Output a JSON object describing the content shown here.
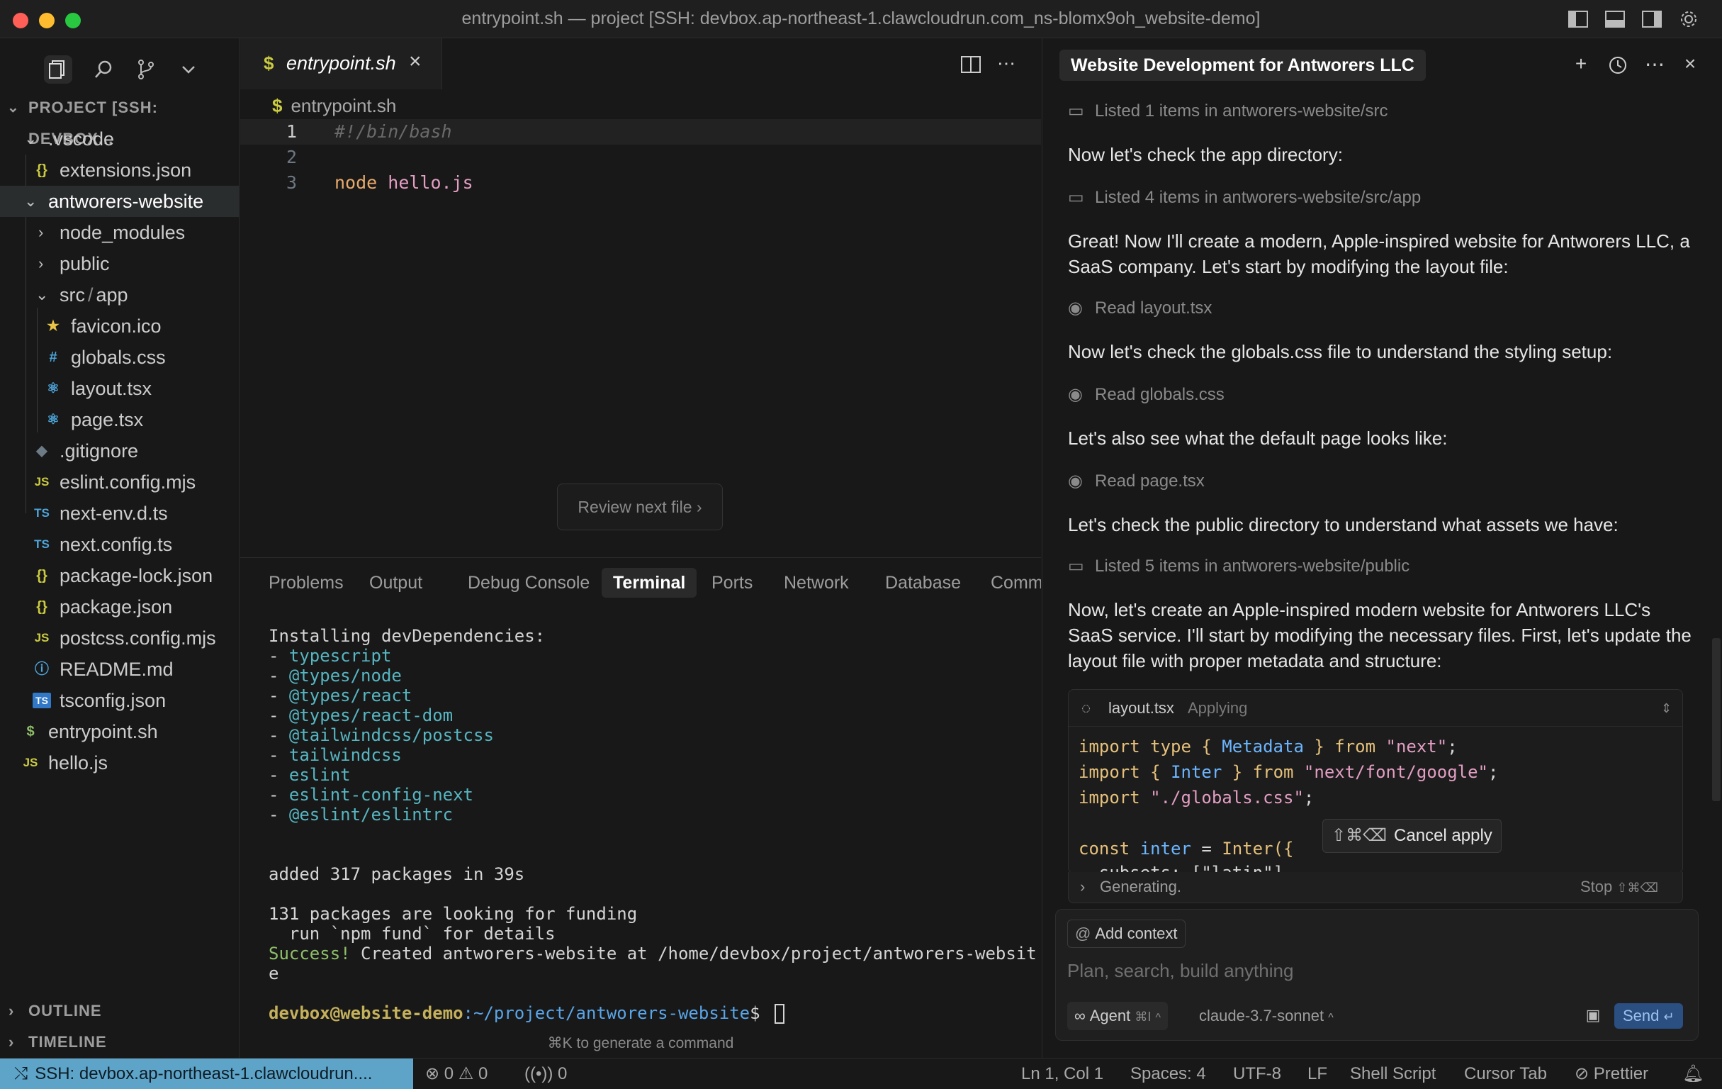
{
  "window": {
    "title": "entrypoint.sh — project [SSH: devbox.ap-northeast-1.clawcloudrun.com_ns-blomx9oh_website-demo]"
  },
  "sidebar": {
    "project_header": "PROJECT [SSH: DEVBOX...",
    "items": [
      {
        "label": ".vscode",
        "icon": "chevron-down"
      },
      {
        "label": "extensions.json",
        "icon": "{}"
      },
      {
        "label": "antworers-website",
        "icon": "chevron-down"
      },
      {
        "label": "node_modules",
        "icon": "chevron-right"
      },
      {
        "label": "public",
        "icon": "chevron-right"
      },
      {
        "label": "src",
        "icon": "chevron-down"
      },
      {
        "label": "app",
        "icon": ""
      },
      {
        "label": "favicon.ico",
        "icon": "star"
      },
      {
        "label": "globals.css",
        "icon": "#"
      },
      {
        "label": "layout.tsx",
        "icon": "react"
      },
      {
        "label": "page.tsx",
        "icon": "react"
      },
      {
        "label": ".gitignore",
        "icon": "diamond"
      },
      {
        "label": "eslint.config.mjs",
        "icon": "JS"
      },
      {
        "label": "next-env.d.ts",
        "icon": "TS"
      },
      {
        "label": "next.config.ts",
        "icon": "TS"
      },
      {
        "label": "package-lock.json",
        "icon": "{}"
      },
      {
        "label": "package.json",
        "icon": "{}"
      },
      {
        "label": "postcss.config.mjs",
        "icon": "JS"
      },
      {
        "label": "README.md",
        "icon": "info"
      },
      {
        "label": "tsconfig.json",
        "icon": "TS"
      },
      {
        "label": "entrypoint.sh",
        "icon": "$"
      },
      {
        "label": "hello.js",
        "icon": "JS"
      }
    ],
    "icon_texts": {
      "braces": "{}",
      "hash": "#",
      "js": "JS",
      "ts": "TS",
      "dollar": "$"
    },
    "outline": "OUTLINE",
    "timeline": "TIMELINE"
  },
  "editor": {
    "tab_label": "entrypoint.sh",
    "tab_icon": "$",
    "breadcrumb": "entrypoint.sh",
    "lines": [
      {
        "n": "1",
        "text": "#!/bin/bash"
      },
      {
        "n": "2",
        "text": ""
      },
      {
        "n": "3",
        "kw": "node",
        "arg": "hello.js"
      }
    ],
    "review_button": "Review next file"
  },
  "panel": {
    "tabs": [
      "Problems",
      "Output",
      "Debug Console",
      "Terminal",
      "Ports",
      "Network",
      "Database",
      "Comm"
    ],
    "active_tab": "Terminal",
    "terminal": {
      "header": "Installing devDependencies:",
      "packages": [
        "typescript",
        "@types/node",
        "@types/react",
        "@types/react-dom",
        "@tailwindcss/postcss",
        "tailwindcss",
        "eslint",
        "eslint-config-next",
        "@eslint/eslintrc"
      ],
      "dash": "- ",
      "added": "added 317 packages in 39s",
      "funding1": "131 packages are looking for funding",
      "funding2": "  run `npm fund` for details",
      "success_word": "Success!",
      "success_rest": " Created antworers-website at /home/devbox/project/antworers-websit",
      "success_wrap": "e",
      "prompt_user": "devbox@website-demo",
      "prompt_path": ":~/project/antworers-website",
      "prompt_end": "$ ",
      "hint": "⌘K to generate a command"
    }
  },
  "chat": {
    "title": "Website Development for Antworers LLC",
    "entries": {
      "tool1": "Listed 1 items in antworers-website/src",
      "msg1": "Now let's check the app directory:",
      "tool2": "Listed 4 items in antworers-website/src/app",
      "msg2": "Great! Now I'll create a modern, Apple-inspired website for Antworers LLC, a SaaS company. Let's start by modifying the layout file:",
      "tool3": "Read layout.tsx",
      "msg3": "Now let's check the globals.css file to understand the styling setup:",
      "tool4": "Read globals.css",
      "msg4": "Let's also see what the default page looks like:",
      "tool5": "Read page.tsx",
      "msg5": "Let's check the public directory to understand what assets we have:",
      "tool6": "Listed 5 items in antworers-website/public",
      "msg6": "Now, let's create an Apple-inspired modern website for Antworers LLC's SaaS service. I'll start by modifying the necessary files. First, let's update the layout file with proper metadata and structure:"
    },
    "code_card": {
      "file": "layout.tsx",
      "status": "Applying",
      "lines": {
        "l1a": "import type ",
        "l1b": "{ ",
        "l1c": "Metadata",
        "l1d": " }",
        "l1e": " from ",
        "l1f": "\"next\"",
        "l1g": ";",
        "l2a": "import ",
        "l2b": "{ ",
        "l2c": "Inter",
        "l2d": " }",
        "l2e": " from ",
        "l2f": "\"next/font/google\"",
        "l2g": ";",
        "l3a": "import ",
        "l3b": "\"./globals.css\"",
        "l3c": ";",
        "l4a": "const ",
        "l4b": "inter",
        "l4c": " = ",
        "l4d": "Inter",
        "l4e": "({",
        "l5": "  subsets: [\"latin\"],"
      },
      "cancel_keys": "⇧⌘⌫",
      "cancel_label": "Cancel apply"
    },
    "generating": "Generating.",
    "stop": "Stop",
    "stop_keys": "⇧⌘⌫",
    "composer": {
      "add_context": "Add context",
      "placeholder": "Plan, search, build anything",
      "agent": "Agent",
      "agent_keys": "⌘I",
      "model": "claude-3.7-sonnet",
      "send": "Send"
    }
  },
  "statusbar": {
    "remote": "SSH: devbox.ap-northeast-1.clawcloudrun....",
    "errors": "0",
    "warnings": "0",
    "ports": "0",
    "position": "Ln 1, Col 1",
    "spaces": "Spaces: 4",
    "encoding": "UTF-8",
    "eol": "LF",
    "language": "Shell Script",
    "tab_mode": "Cursor Tab",
    "formatter": "Prettier"
  }
}
